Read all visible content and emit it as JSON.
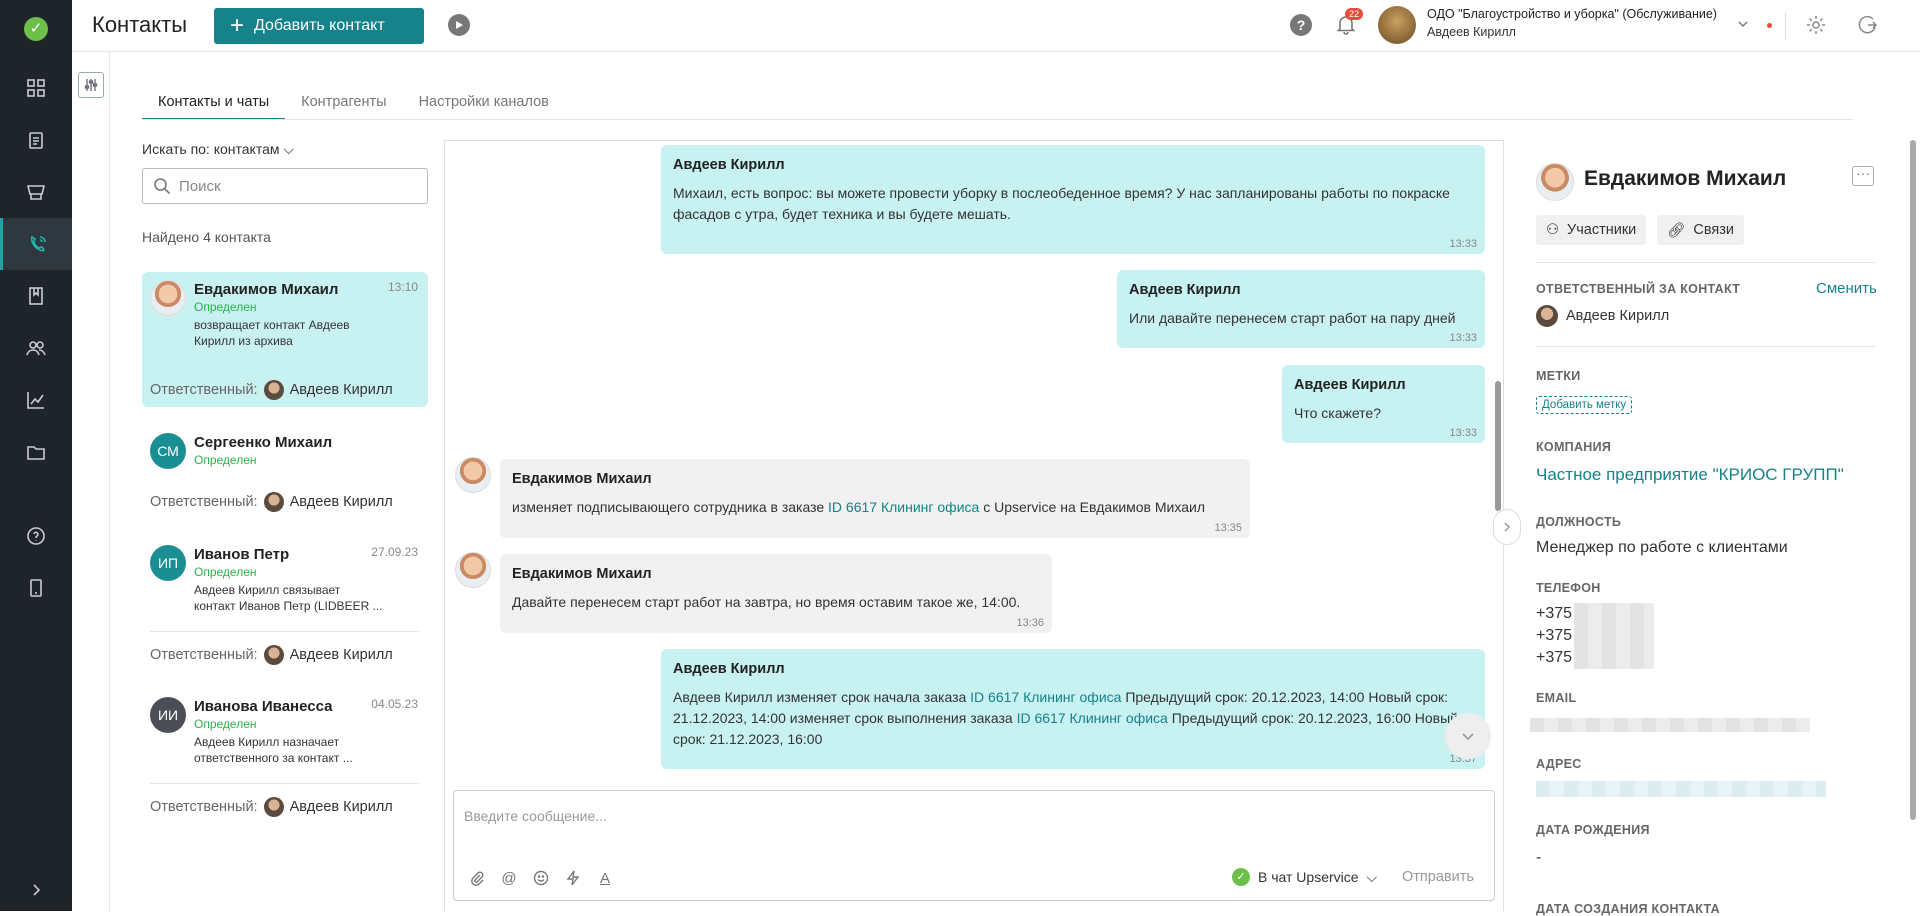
{
  "app": {
    "title": "Контакты",
    "add_button": "Добавить контакт"
  },
  "topbar": {
    "notifications_count": "22",
    "org_name": "ОДО \"Благоустройство и уборка\" (Обслуживание)",
    "user_name": "Авдеев Кирилл"
  },
  "tabs": [
    {
      "label": "Контакты и чаты",
      "active": true
    },
    {
      "label": "Контрагенты",
      "active": false
    },
    {
      "label": "Настройки каналов",
      "active": false
    }
  ],
  "search": {
    "by_label": "Искать по: контактам",
    "placeholder": "Поиск",
    "found": "Найдено 4 контакта"
  },
  "responsible_label": "Ответственный:",
  "contacts": [
    {
      "name": "Евдакимов Михаил",
      "time": "13:10",
      "status": "Определен",
      "desc": "возвращает контакт Авдеев Кирилл из архива",
      "responsible": "Авдеев Кирилл",
      "initials": ""
    },
    {
      "name": "Сергеенко Михаил",
      "time": "",
      "status": "Определен",
      "desc": "",
      "responsible": "Авдеев Кирилл",
      "initials": "СМ"
    },
    {
      "name": "Иванов Петр",
      "time": "27.09.23",
      "status": "Определен",
      "desc": "Авдеев Кирилл связывает контакт Иванов Петр (LIDBEER ...",
      "responsible": "Авдеев Кирилл",
      "initials": "ИП"
    },
    {
      "name": "Иванова Иванесса",
      "time": "04.05.23",
      "status": "Определен",
      "desc": "Авдеев Кирилл назначает ответственного за контакт ...",
      "responsible": "Авдеев Кирилл",
      "initials": "ИИ"
    }
  ],
  "messages": [
    {
      "author": "Авдеев Кирилл",
      "text": "Михаил, есть вопрос: вы можете провести уборку в послеобеденное время? У нас запланированы работы по покраске фасадов с утра, будет техника и вы будете мешать.",
      "time": "13:33"
    },
    {
      "author": "Авдеев Кирилл",
      "text": "Или давайте перенесем старт работ на пару дней",
      "time": "13:33"
    },
    {
      "author": "Авдеев Кирилл",
      "text": "Что скажете?",
      "time": "13:33"
    },
    {
      "author": "Евдакимов Михаил",
      "text_before": "изменяет подписывающего сотрудника в заказе ",
      "link": "ID 6617 Клининг офиса",
      "text_after": " с Upservice на Евдакимов Михаил",
      "time": "13:35"
    },
    {
      "author": "Евдакимов Михаил",
      "text": "Давайте перенесем старт работ на завтра, но время оставим такое же, 14:00.",
      "time": "13:36"
    },
    {
      "author": "Авдеев Кирилл",
      "p1": "Авдеев Кирилл изменяет срок начала заказа ",
      "link1": "ID 6617 Клининг офиса",
      "p2": " Предыдущий срок: 20.12.2023, 14:00 Новый срок: 21.12.2023, 14:00 изменяет срок выполнения заказа ",
      "link2": "ID 6617 Клининг офиса",
      "p3": " Предыдущий срок: 20.12.2023, 16:00 Новый срок: 21.12.2023, 16:00",
      "time": "13:37"
    }
  ],
  "composer": {
    "placeholder": "Введите сообщение...",
    "channel": "В чат Upservice",
    "send": "Отправить"
  },
  "profile": {
    "name": "Евдакимов Михаил",
    "chip_members": "Участники",
    "chip_links": "Связи",
    "responsible_label": "ОТВЕТСТВЕННЫЙ ЗА КОНТАКТ",
    "change": "Сменить",
    "responsible": "Авдеев Кирилл",
    "tags_label": "МЕТКИ",
    "add_tag": "Добавить метку",
    "company_label": "КОМПАНИЯ",
    "company": "Частное предприятие \"КРИОС ГРУПП\"",
    "position_label": "ДОЛЖНОСТЬ",
    "position": "Менеджер по работе с клиентами",
    "phone_label": "ТЕЛЕФОН",
    "phones": [
      "+375",
      "+375",
      "+375"
    ],
    "email_label": "EMAIL",
    "address_label": "АДРЕС",
    "birthday_label": "ДАТА РОЖДЕНИЯ",
    "birthday": "-",
    "created_label": "ДАТА СОЗДАНИЯ КОНТАКТА"
  },
  "colors": {
    "accent": "#16828a",
    "sidebar": "#1f2429",
    "out_bubble": "#c8f1f2",
    "in_bubble": "#f1f1f1",
    "status_green": "#2bb34a"
  }
}
